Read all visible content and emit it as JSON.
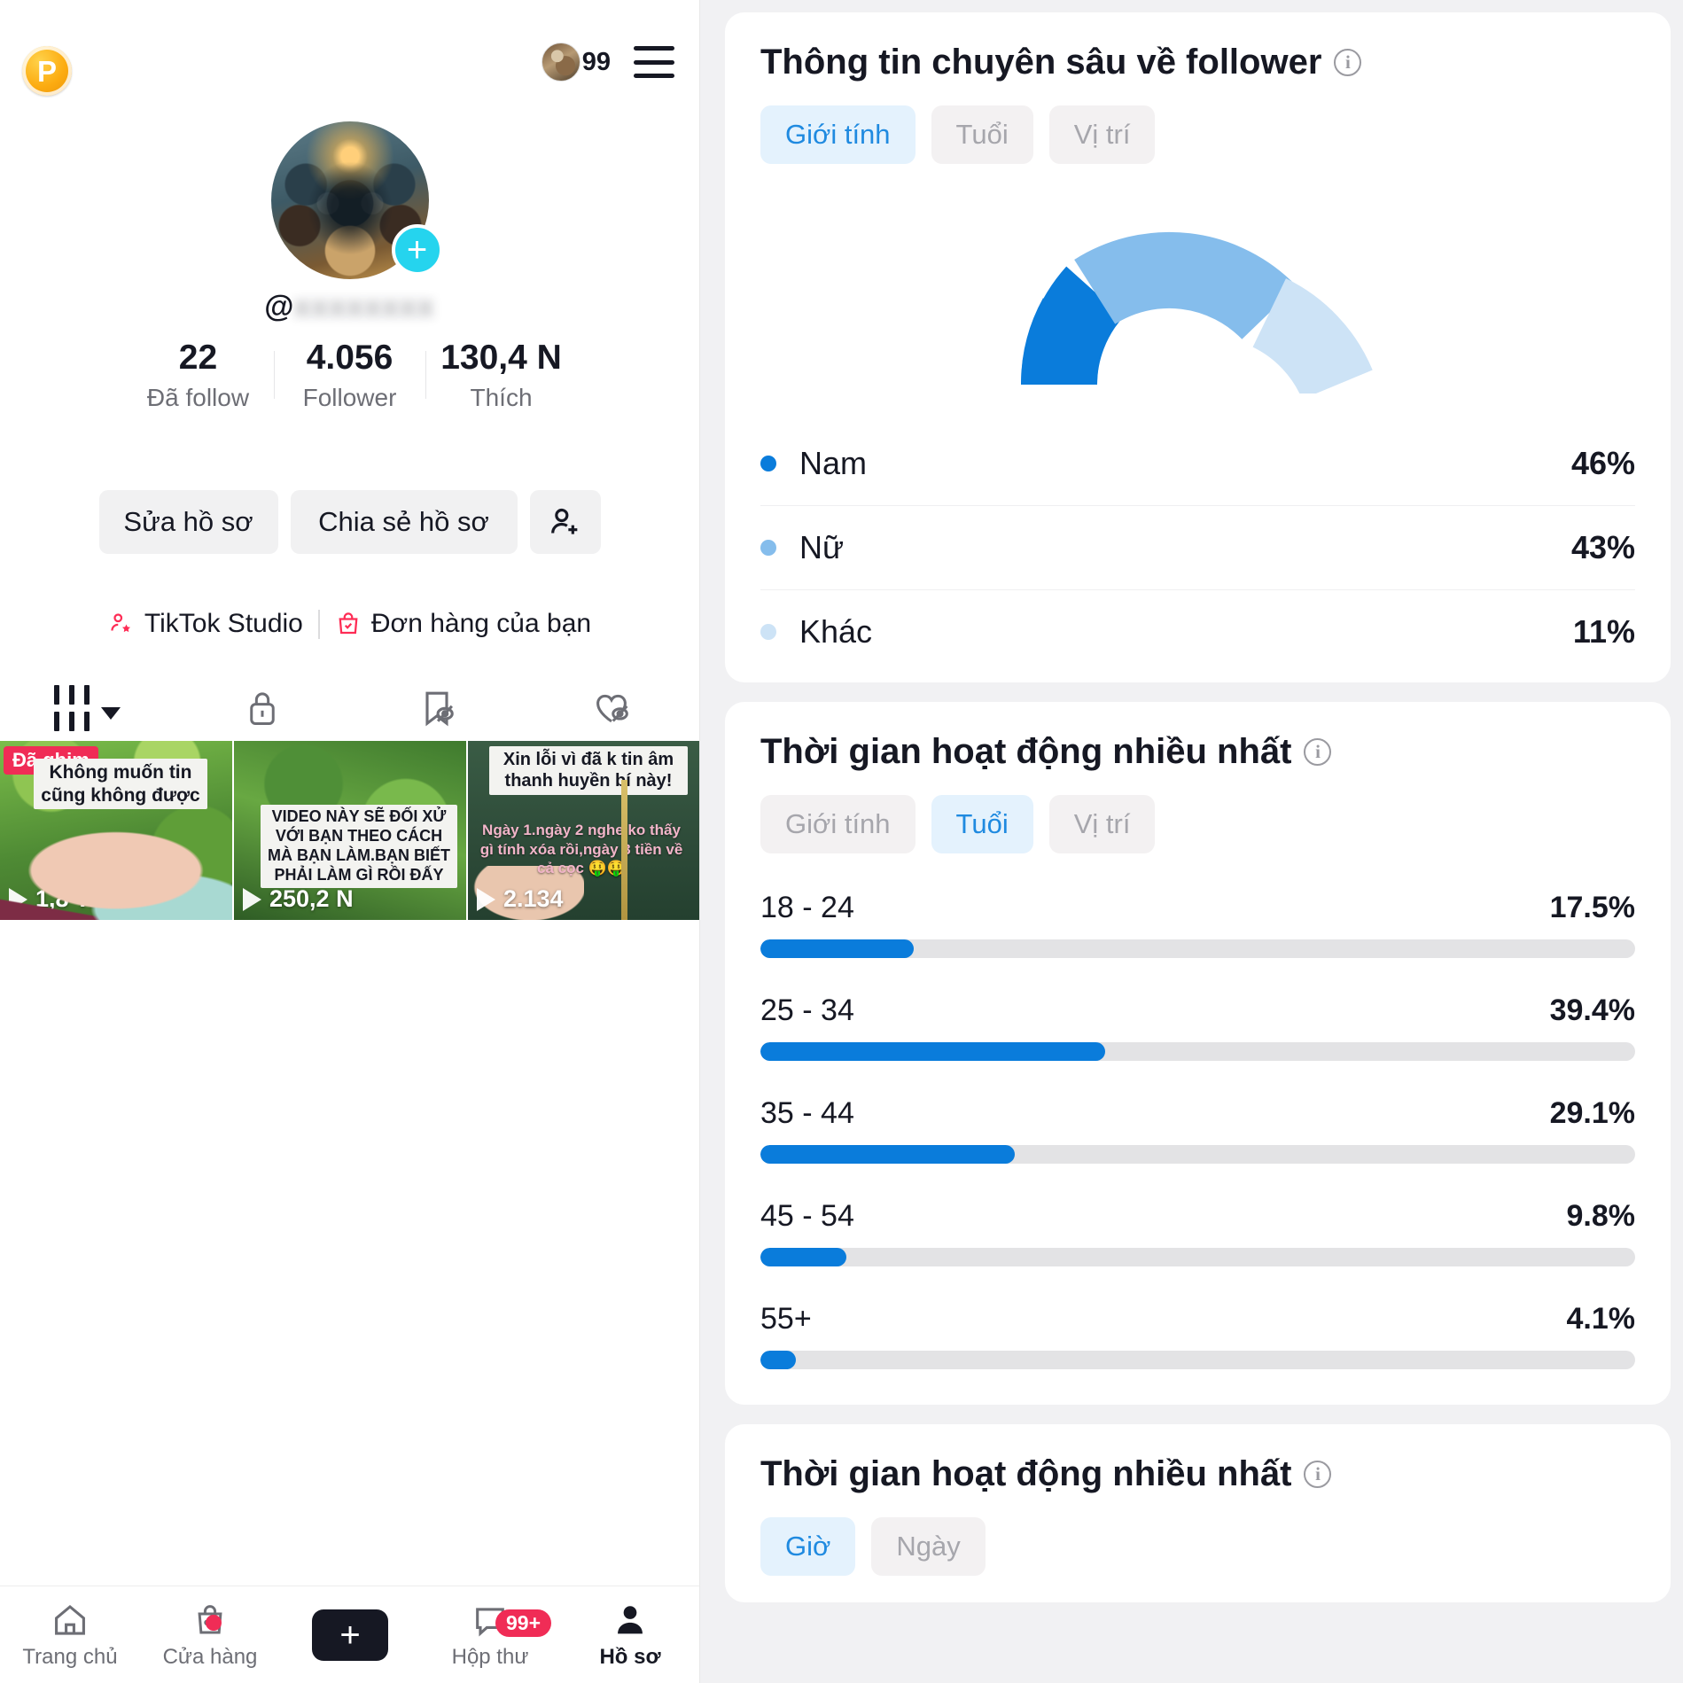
{
  "left": {
    "topbar": {
      "coin_label": "P",
      "avatar_count": "99",
      "menu_icon": "hamburger-menu-icon"
    },
    "profile": {
      "handle_prefix": "@",
      "handle_blurred": "xxxxxxxx",
      "avatar_plus_icon": "plus-icon",
      "stats": [
        {
          "value": "22",
          "label": "Đã follow"
        },
        {
          "value": "4.056",
          "label": "Follower"
        },
        {
          "value": "130,4 N",
          "label": "Thích"
        }
      ],
      "buttons": {
        "edit": "Sửa hồ sơ",
        "share": "Chia sẻ hồ sơ",
        "add_friend_icon": "person-add-icon"
      },
      "links": [
        {
          "icon": "person-star-icon",
          "label": "TikTok Studio"
        },
        {
          "icon": "shopping-bag-check-icon",
          "label": "Đơn hàng của bạn"
        }
      ]
    },
    "tabs": [
      {
        "icon": "grid-posts-icon",
        "active": true
      },
      {
        "icon": "lock-private-icon",
        "active": false
      },
      {
        "icon": "bookmark-off-icon",
        "active": false
      },
      {
        "icon": "heart-off-icon",
        "active": false
      }
    ],
    "videos": [
      {
        "pin_badge": "Đã ghim",
        "overlay": "Không muốn tin cũng không được",
        "plays": "1,8 Tr"
      },
      {
        "pin_badge": "",
        "overlay": "VIDEO NÀY SẼ ĐỐI XỬ VỚI BẠN THEO CÁCH MÀ BẠN LÀM.BẠN BIẾT PHẢI LÀM GÌ RỒI ĐẤY",
        "plays": "250,2 N"
      },
      {
        "pin_badge": "",
        "overlay": "Xin lỗi vì đã k tin âm thanh huyền bí này!",
        "overlay2": "Ngày 1.ngày 2 nghe ko thấy gì tính xóa rồi,ngày 3 tiền về cả cọc 🤑🤑",
        "plays": "2.134"
      }
    ],
    "bottom_nav": [
      {
        "icon": "home-icon",
        "label": "Trang chủ",
        "active": false
      },
      {
        "icon": "shop-bag-icon",
        "label": "Cửa hàng",
        "active": false,
        "dot": true
      },
      {
        "icon": "create-plus-icon",
        "label": "",
        "active": false
      },
      {
        "icon": "inbox-message-icon",
        "label": "Hộp thư",
        "active": false,
        "badge": "99+"
      },
      {
        "icon": "profile-person-icon",
        "label": "Hồ sơ",
        "active": true
      }
    ]
  },
  "right": {
    "cards": [
      {
        "title": "Thông tin chuyên sâu về follower",
        "info_icon": "info-icon",
        "segments": [
          {
            "label": "Giới tính",
            "active": true
          },
          {
            "label": "Tuổi",
            "active": false
          },
          {
            "label": "Vị trí",
            "active": false
          }
        ]
      },
      {
        "title": "Thời gian hoạt động nhiều nhất",
        "info_icon": "info-icon",
        "segments": [
          {
            "label": "Giới tính",
            "active": false
          },
          {
            "label": "Tuổi",
            "active": true
          },
          {
            "label": "Vị trí",
            "active": false
          }
        ]
      },
      {
        "title": "Thời gian hoạt động nhiều nhất",
        "info_icon": "info-icon",
        "segments": [
          {
            "label": "Giờ",
            "active": true
          },
          {
            "label": "Ngày",
            "active": false
          }
        ]
      }
    ]
  },
  "chart_data": [
    {
      "type": "pie",
      "title": "Thông tin chuyên sâu về follower",
      "subtitle": "Giới tính",
      "shape": "half-donut",
      "labels": [
        "Nam",
        "Nữ",
        "Khác"
      ],
      "values": [
        46,
        43,
        11
      ],
      "value_labels": [
        "46%",
        "43%",
        "11%"
      ],
      "colors": [
        "#0a7cdb",
        "#85bdec",
        "#cde3f6"
      ],
      "legend": "bottom-list",
      "unit": "%"
    },
    {
      "type": "bar",
      "orientation": "horizontal",
      "title": "Thời gian hoạt động nhiều nhất",
      "subtitle": "Tuổi",
      "categories": [
        "18 - 24",
        "25 - 34",
        "35 - 44",
        "45 - 54",
        "55+"
      ],
      "values": [
        17.5,
        39.4,
        29.1,
        9.8,
        4.1
      ],
      "value_labels": [
        "17.5%",
        "39.4%",
        "29.1%",
        "9.8%",
        "4.1%"
      ],
      "xlabel": "",
      "ylabel": "",
      "xlim": [
        0,
        100
      ],
      "bar_color": "#0a7cdb",
      "track_color": "#e3e3e5",
      "grid": false,
      "legend": "none"
    }
  ],
  "colors": {
    "accent_blue": "#0a7cdb",
    "light_blue": "#85bdec",
    "pale_blue": "#cde3f6",
    "tiktok_pink": "#fe2c55",
    "tiktok_cyan": "#25f4ee",
    "coin_gold": "#fcab10"
  }
}
